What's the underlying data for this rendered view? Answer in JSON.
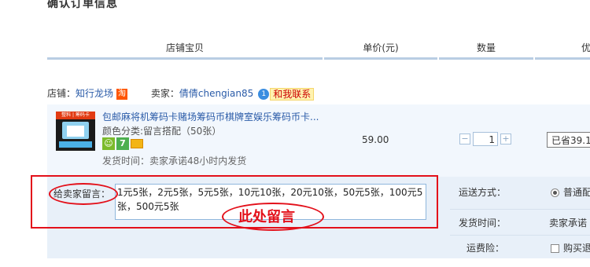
{
  "page": {
    "section_title": "确认订单信息"
  },
  "table_headers": [
    "店铺宝贝",
    "单价(元)",
    "数量",
    "优"
  ],
  "shop": {
    "label": "店铺：",
    "name": "知行龙场",
    "tao_badge": "淘",
    "seller_label": "卖家：",
    "seller_name": "倩倩chengian85",
    "wangwang_icon": "1",
    "contact": "和我联系"
  },
  "item": {
    "thumb_label": "整料 | 筹码卡",
    "title": "包邮麻将机筹码卡赌场筹码币棋牌室娱乐筹码币卡...",
    "spec": "颜色分类:留言搭配（50张）",
    "badge_icons": [
      "seven-day-return-icon",
      "seven-icon",
      "credit-card-icon"
    ],
    "badge_seven": "7",
    "shipping": "发货时间：卖家承诺48小时内发货",
    "price": "59.00",
    "quantity": "1",
    "qty_minus": "−",
    "qty_plus": "+",
    "discount": "已省39.1"
  },
  "message": {
    "label": "给卖家留言：",
    "value": "1元5张，2元5张，5元5张，10元10张，20元10张，50元5张，100元5张，500元5张"
  },
  "annotation": {
    "text": "此处留言",
    "color": "#e3101a"
  },
  "options": {
    "shipping_method_label": "运送方式：",
    "shipping_method_value": "普通配",
    "delivery_time_label": "发货时间：",
    "delivery_time_value": "卖家承诺",
    "insurance_label": "运费险：",
    "insurance_value": "购买退"
  },
  "colors": {
    "accent_blue": "#2a5ba8",
    "header_line": "#b9cde3",
    "annotation_red": "#e3101a"
  }
}
